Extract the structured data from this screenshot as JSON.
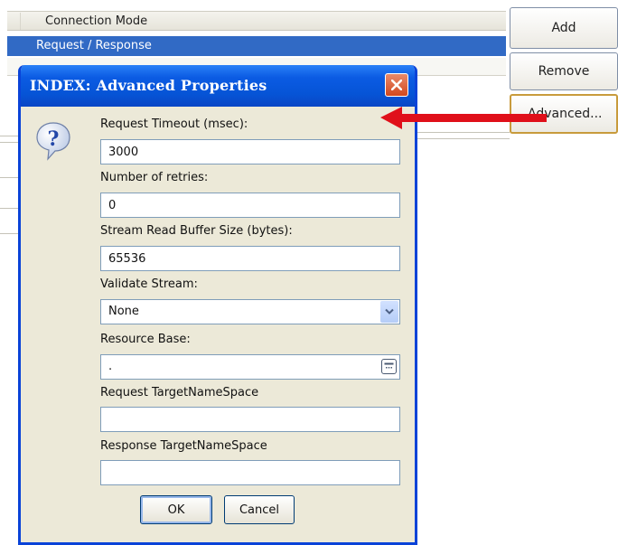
{
  "background": {
    "list_header": "Connection Mode",
    "selected_row": "Request / Response"
  },
  "side_buttons": {
    "add": "Add",
    "remove": "Remove",
    "advanced": "Advanced..."
  },
  "dialog": {
    "title": "INDEX: Advanced Properties",
    "icon": "question-mark-icon",
    "fields": {
      "request_timeout": {
        "label": "Request Timeout (msec):",
        "value": "3000"
      },
      "retries": {
        "label": "Number of retries:",
        "value": "0"
      },
      "buffer_size": {
        "label": "Stream Read Buffer Size (bytes):",
        "value": "65536"
      },
      "validate_stream": {
        "label": "Validate Stream:",
        "value": "None"
      },
      "resource_base": {
        "label": "Resource Base:",
        "value": "."
      },
      "request_ns": {
        "label": "Request TargetNameSpace",
        "value": ""
      },
      "response_ns": {
        "label": "Response TargetNameSpace",
        "value": ""
      }
    },
    "buttons": {
      "ok": "OK",
      "cancel": "Cancel"
    }
  },
  "colors": {
    "title_bar": "#0654d6",
    "selection": "#316ac5",
    "dialog_face": "#ece9d8",
    "arrow": "#e0101a"
  }
}
